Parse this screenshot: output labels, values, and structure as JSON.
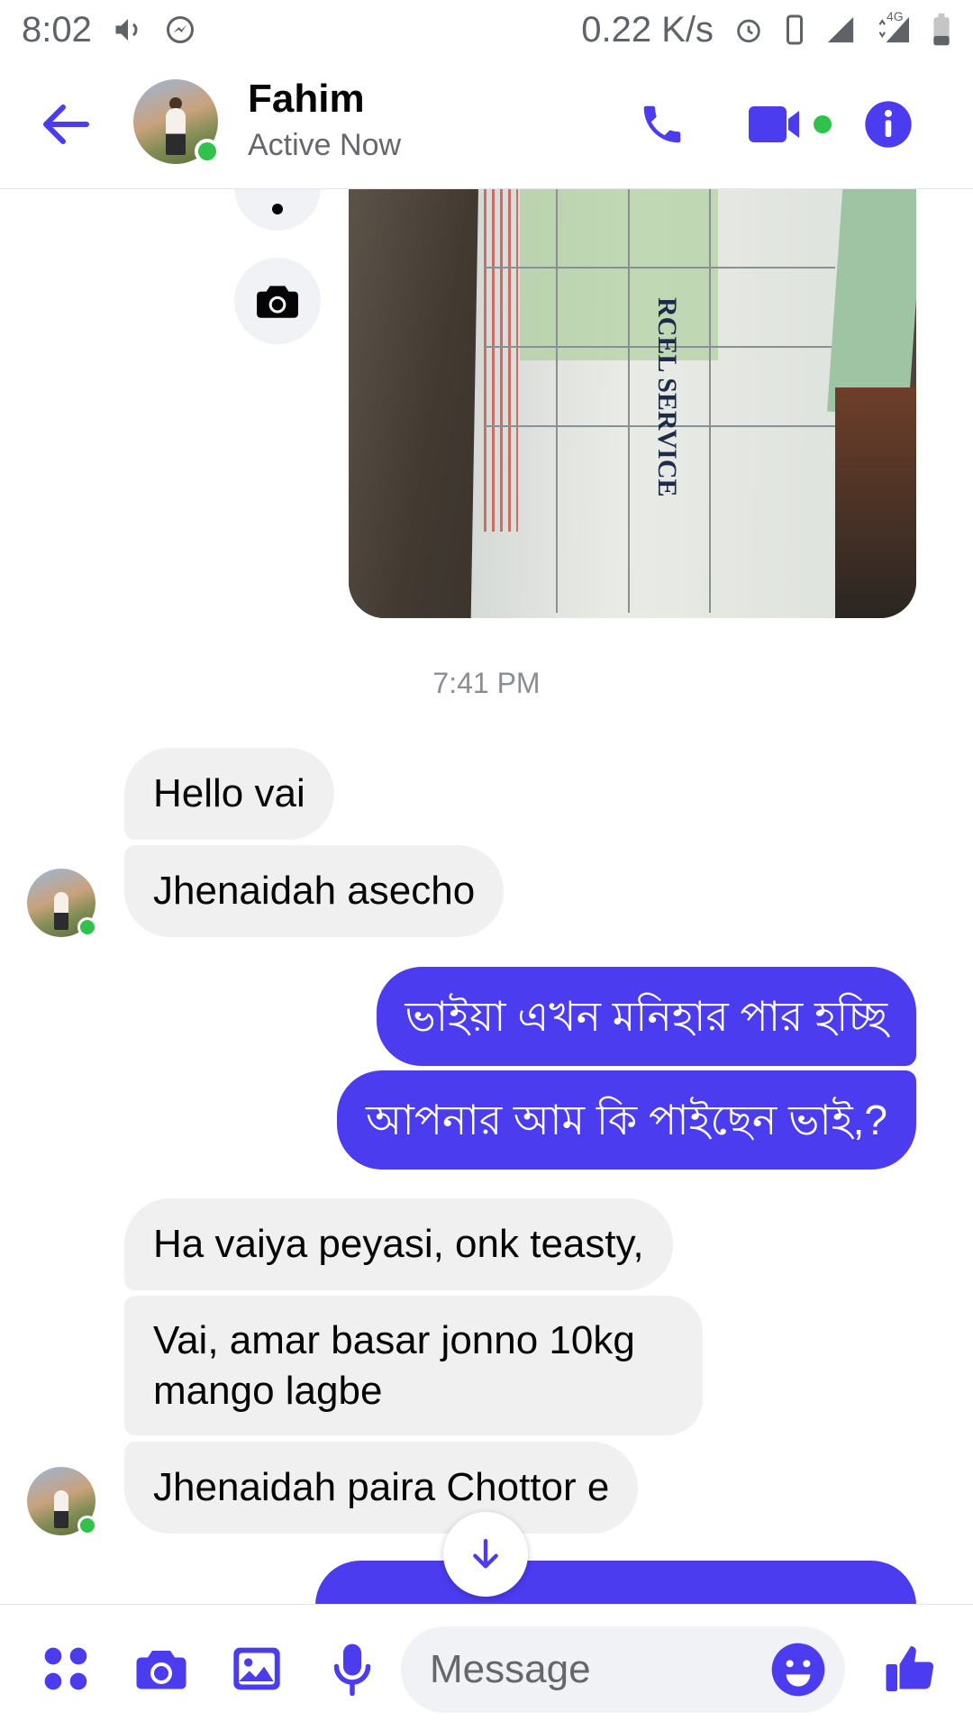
{
  "status_bar": {
    "time": "8:02",
    "net_speed": "0.22 K/s",
    "network_badge": "4G"
  },
  "header": {
    "name": "Fahim",
    "status": "Active Now"
  },
  "photo": {
    "slip_title_fragment": "RCEL SERVICE"
  },
  "conversation": {
    "timestamp": "7:41 PM",
    "messages": [
      {
        "side": "in",
        "text": "Hello vai"
      },
      {
        "side": "in",
        "text": "Jhenaidah asecho"
      },
      {
        "side": "out",
        "text": "ভাইয়া এখন মনিহার পার হচ্ছি"
      },
      {
        "side": "out",
        "text": "আপনার আম কি পাইছেন ভাই,?"
      },
      {
        "side": "in",
        "text": "Ha vaiya peyasi, onk teasty,"
      },
      {
        "side": "in",
        "text": "Vai, amar basar jonno 10kg mango lagbe"
      },
      {
        "side": "in",
        "text": "Jhenaidah paira Chottor e"
      }
    ],
    "wrapped_lines": [
      "Vai, amar basar jonno 10kg",
      "mango lagbe"
    ]
  },
  "composer": {
    "placeholder": "Message"
  },
  "colors": {
    "accent": "#4b3cf0",
    "incoming_bubble": "#f0f0f0",
    "online": "#31c24b"
  },
  "icons": {
    "back": "back-arrow-icon",
    "call": "phone-icon",
    "video": "video-camera-icon",
    "info": "info-icon",
    "camera": "camera-icon",
    "scroll": "arrow-down-icon",
    "apps": "four-dots-icon",
    "gallery": "image-icon",
    "mic": "microphone-icon",
    "emoji": "emoji-icon",
    "like": "thumbs-up-icon"
  }
}
